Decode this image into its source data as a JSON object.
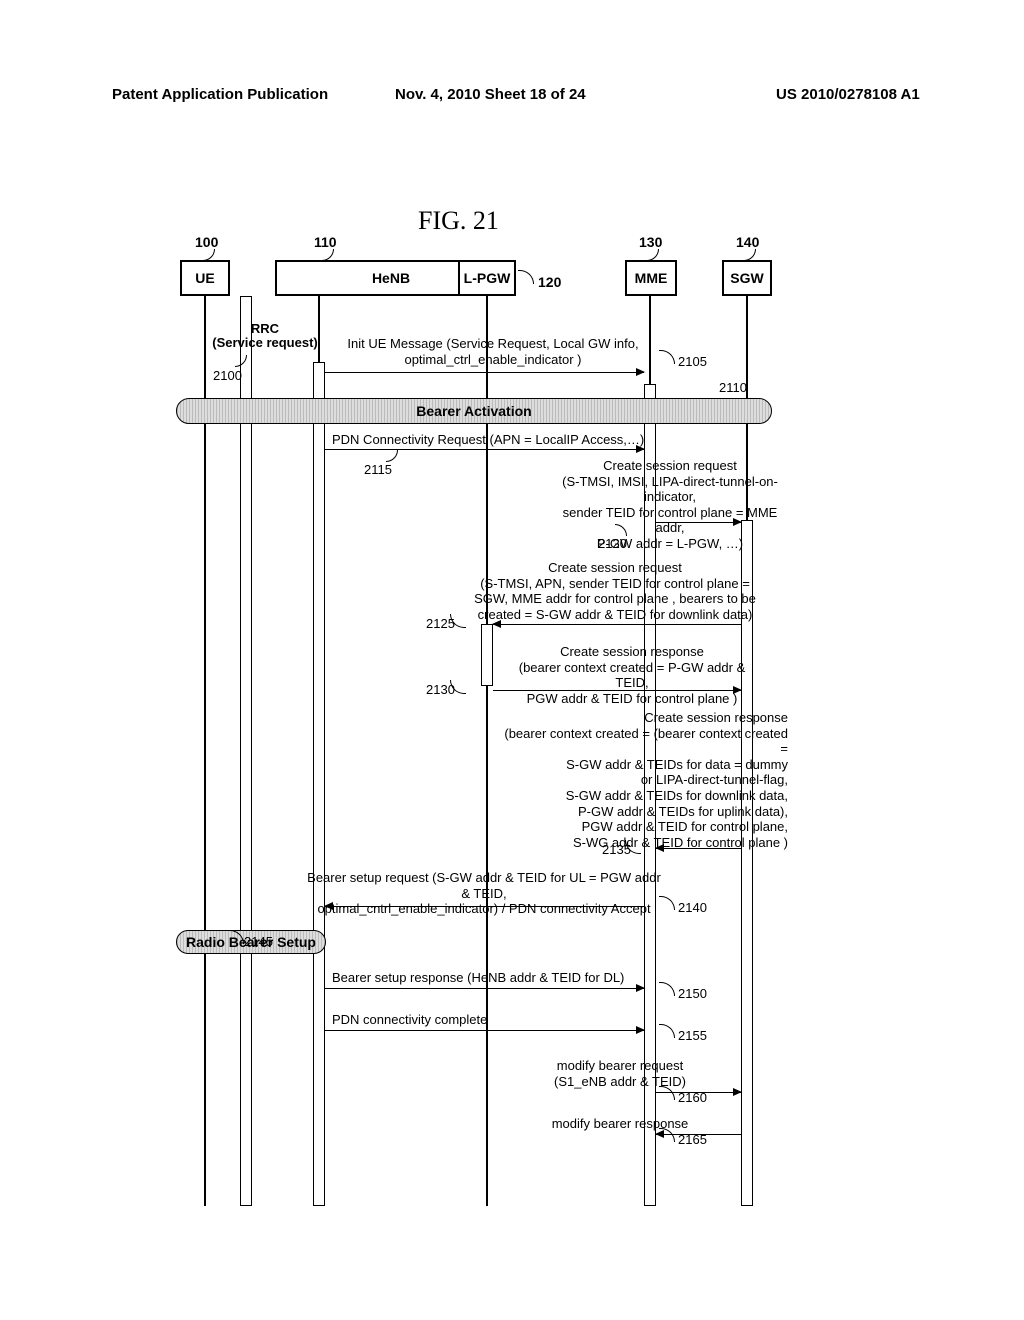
{
  "header": {
    "left": "Patent Application Publication",
    "center": "Nov. 4, 2010  Sheet 18 of 24",
    "right": "US 2010/0278108 A1"
  },
  "figure": "FIG.  21",
  "nodes": {
    "ue": {
      "label": "UE",
      "ref": "100"
    },
    "henb": {
      "label": "HeNB",
      "ref": "110"
    },
    "lpgw": {
      "label": "L-PGW",
      "ref": "120"
    },
    "mme": {
      "label": "MME",
      "ref": "130"
    },
    "sgw": {
      "label": "SGW",
      "ref": "140"
    }
  },
  "rrc": {
    "line1": "RRC",
    "line2": "(Service request)",
    "ref": "2100"
  },
  "messages": {
    "init": "Init UE Message (Service Request, Local GW info,\noptimal_ctrl_enable_indicator )",
    "init_ref": "2105",
    "bearer_activation": "Bearer Activation",
    "ba_ref": "2110",
    "pdn_req": "PDN Connectivity Request (APN = LocalIP Access,…)",
    "pdn_ref": "2115",
    "csr1": "Create session request\n(S-TMSI, IMSI,  LIPA-direct-tunnel-on-indicator,\nsender TEID for control plane = MME addr,\nP-GW addr = L-PGW, …)",
    "csr1_ref": "2120",
    "csr2": "Create session request\n(S-TMSI, APN, sender TEID for control plane =\nSGW, MME addr for control plane , bearers to be\ncreated = S-GW addr & TEID for downlink data)",
    "csr2_ref": "2125",
    "csresp1": "Create session response\n(bearer context created = P-GW addr & TEID,\nPGW addr & TEID for control plane  )",
    "csresp1_ref": "2130",
    "csresp2": "Create session response\n(bearer context created = (bearer context created =\nS-GW addr & TEIDs  for data = dummy\nor LIPA-direct-tunnel-flag,\nS-GW addr & TEIDs for downlink data,\nP-GW addr & TEIDs for uplink data),\nPGW addr & TEID for control plane,\nS-WG addr & TEID for control plane )",
    "csresp2_ref": "2135",
    "bsr": "Bearer setup request (S-GW addr & TEID for UL = PGW addr & TEID,\noptimal_cntrl_enable_indicator) / PDN connectivity Accept",
    "bsr_ref": "2140",
    "radio": "Radio Bearer Setup",
    "radio_ref": "2145",
    "bsresp": "Bearer setup response (HeNB addr & TEID for DL)",
    "bsresp_ref": "2150",
    "pdn_complete": "PDN connectivity complete",
    "pdn_complete_ref": "2155",
    "mbr": "modify bearer request\n(S1_eNB addr & TEID)",
    "mbr_ref": "2160",
    "mbresp": "modify bearer response",
    "mbresp_ref": "2165"
  }
}
